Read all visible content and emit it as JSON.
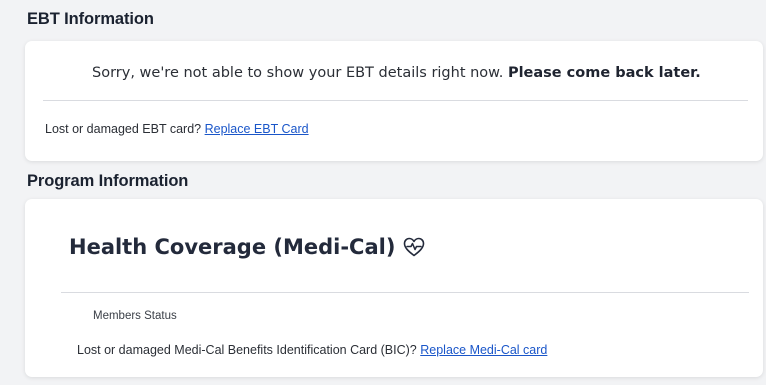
{
  "ebt": {
    "heading": "EBT Information",
    "message_regular": "Sorry, we're not able to show your EBT details right now. ",
    "message_bold": "Please come back later.",
    "lost_label": "Lost or damaged EBT card? ",
    "replace_link": "Replace EBT Card"
  },
  "program": {
    "heading": "Program Information",
    "coverage_title": "Health Coverage (Medi-Cal)",
    "coverage_icon": "heart-pulse-icon",
    "members_status_label": "Members Status",
    "lost_label": "Lost or damaged Medi-Cal Benefits Identification Card (BIC)? ",
    "replace_link": "Replace Medi-Cal card"
  },
  "colors": {
    "link": "#1a56c9",
    "heading": "#1b2230",
    "card_background": "#ffffff",
    "page_background": "#f2f3f5"
  }
}
